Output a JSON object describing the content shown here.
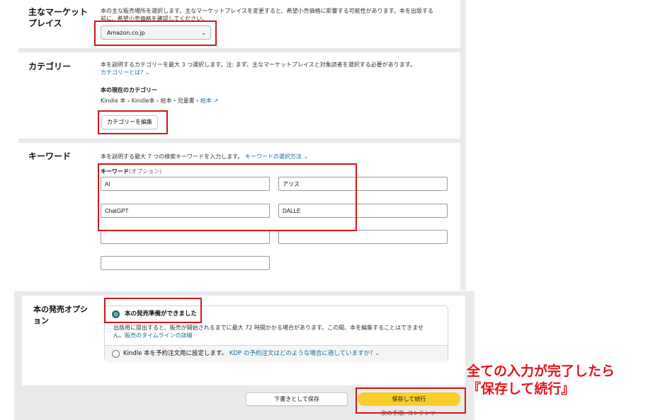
{
  "marketplace": {
    "title_line1": "主なマーケット",
    "title_line2": "プレイス",
    "description_line1": "本の主な販売場所を選択します。主なマーケットプレイスを変更すると、希望小売価格に影響する可能性があります。本を出版する",
    "description_line2": "前に、希望小売価格を確認してください。",
    "selected": "Amazon.co.jp"
  },
  "category": {
    "title": "カテゴリー",
    "description": "本を説明するカテゴリーを最大 3 つ選択します。注: まず、主なマーケットプレイスと対象読者を選択する必要があります。",
    "help_link": "カテゴリーとは?",
    "current_label": "本の現在のカテゴリー",
    "current_path": "Kindle 本 › Kindle本 › 絵本・児童書 ›",
    "current_path_link": "絵本 ↗",
    "edit_button": "カテゴリーを編集"
  },
  "keywords": {
    "title": "キーワード",
    "description": "本を説明する最大 7 つの検索キーワードを入力します。",
    "help_link": "キーワードの選択方法",
    "field_label": "キーワード",
    "field_label_optional": "(オプション)",
    "values": [
      "AI",
      "アリス",
      "ChatGPT",
      "DALLE",
      "",
      "",
      ""
    ]
  },
  "release": {
    "title_line1": "本の発売オプシ",
    "title_line2": "ョン",
    "option_ready": "本の発売準備ができました",
    "option_ready_desc_line1": "出版用に提出すると、販売が開始されるまでに最大 72 時間かかる場合があります。この間、本を編集することはできませ",
    "option_ready_desc_line2": "ん。",
    "timeline_link": "販売のタイムラインの詳細",
    "option_preorder": "Kindle 本を予約注文用に設定します。",
    "preorder_link": "KDP の予約注文はどのような場合に適していますか?"
  },
  "footer": {
    "save_draft": "下書きとして保存",
    "save_continue": "保存して続行",
    "next_step": "次の手順: コンテンツ"
  },
  "annotation": {
    "line1": "全ての入力が完了したら",
    "line2": "『保存して続行』"
  },
  "colors": {
    "accent_red": "#d21717",
    "primary_button": "#f7ce2a",
    "radio_selected": "#1f6f76",
    "link": "#0f6fa3"
  }
}
